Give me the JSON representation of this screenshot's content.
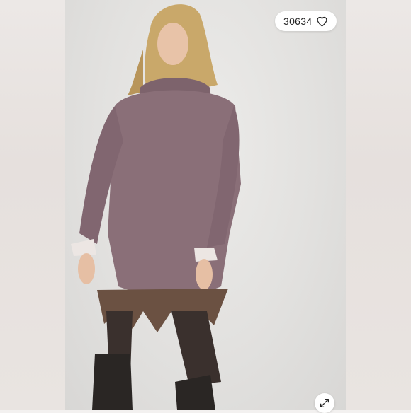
{
  "listing": {
    "like_count": "30634",
    "icons": {
      "like": "heart-outline-icon",
      "expand": "expand-arrows-icon"
    }
  },
  "colors": {
    "sweater": "#8a6f78",
    "background": "#e2e1df",
    "boots": "#2a2624"
  }
}
